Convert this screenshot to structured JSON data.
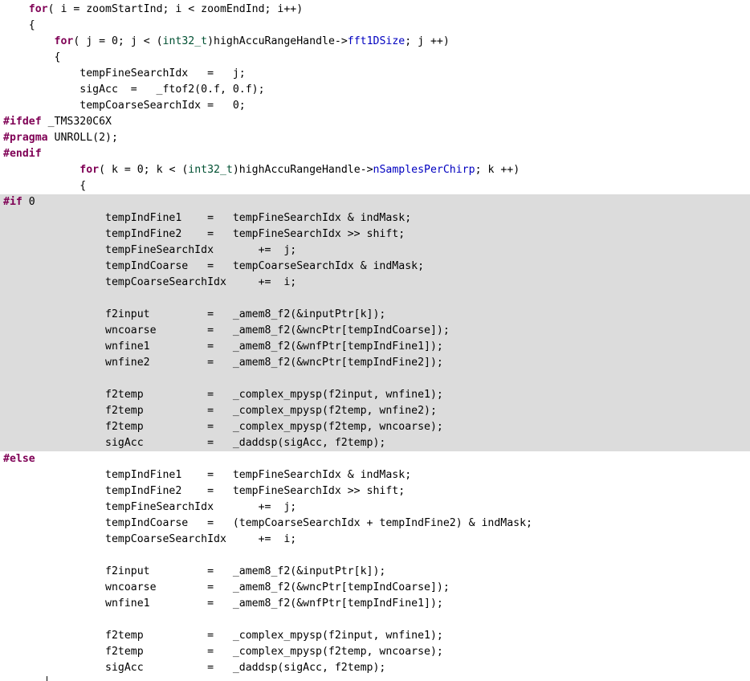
{
  "colors": {
    "background": "#ffffff",
    "inactive_block": "#dcdcdc",
    "keyword": "#7f0055",
    "type": "#005032",
    "field": "#0000c0",
    "text": "#000000"
  },
  "code": {
    "lines": [
      {
        "tokens": [
          {
            "t": "    ",
            "c": "plain"
          },
          {
            "t": "for",
            "c": "kw"
          },
          {
            "t": "( i = zoomStartInd; i < zoomEndInd; i++)",
            "c": "plain"
          }
        ]
      },
      {
        "tokens": [
          {
            "t": "    {",
            "c": "plain"
          }
        ]
      },
      {
        "tokens": [
          {
            "t": "        ",
            "c": "plain"
          },
          {
            "t": "for",
            "c": "kw"
          },
          {
            "t": "( j = 0; j < (",
            "c": "plain"
          },
          {
            "t": "int32_t",
            "c": "type"
          },
          {
            "t": ")highAccuRangeHandle->",
            "c": "plain"
          },
          {
            "t": "fft1DSize",
            "c": "field"
          },
          {
            "t": "; j ++)",
            "c": "plain"
          }
        ]
      },
      {
        "tokens": [
          {
            "t": "        {",
            "c": "plain"
          }
        ]
      },
      {
        "tokens": [
          {
            "t": "            tempFineSearchIdx   =   j;",
            "c": "plain"
          }
        ]
      },
      {
        "tokens": [
          {
            "t": "            sigAcc  =   _ftof2(0.f, 0.f);",
            "c": "plain"
          }
        ]
      },
      {
        "tokens": [
          {
            "t": "            tempCoarseSearchIdx =   0;",
            "c": "plain"
          }
        ]
      },
      {
        "tokens": [
          {
            "t": "#ifdef",
            "c": "pp"
          },
          {
            "t": " _TMS320C6X",
            "c": "plain"
          }
        ]
      },
      {
        "tokens": [
          {
            "t": "#pragma",
            "c": "pp"
          },
          {
            "t": " UNROLL(2);",
            "c": "plain"
          }
        ]
      },
      {
        "tokens": [
          {
            "t": "#endif",
            "c": "pp"
          }
        ]
      },
      {
        "tokens": [
          {
            "t": "            ",
            "c": "plain"
          },
          {
            "t": "for",
            "c": "kw"
          },
          {
            "t": "( k = 0; k < (",
            "c": "plain"
          },
          {
            "t": "int32_t",
            "c": "type"
          },
          {
            "t": ")highAccuRangeHandle->",
            "c": "plain"
          },
          {
            "t": "nSamplesPerChirp",
            "c": "field"
          },
          {
            "t": "; k ++)",
            "c": "plain"
          }
        ]
      },
      {
        "tokens": [
          {
            "t": "            {",
            "c": "plain"
          }
        ]
      },
      {
        "inactive": true,
        "tokens": [
          {
            "t": "#if",
            "c": "pp"
          },
          {
            "t": " 0",
            "c": "plain"
          }
        ]
      },
      {
        "inactive": true,
        "tokens": [
          {
            "t": "                tempIndFine1    =   tempFineSearchIdx & indMask;",
            "c": "plain"
          }
        ]
      },
      {
        "inactive": true,
        "tokens": [
          {
            "t": "                tempIndFine2    =   tempFineSearchIdx >> shift;",
            "c": "plain"
          }
        ]
      },
      {
        "inactive": true,
        "tokens": [
          {
            "t": "                tempFineSearchIdx       +=  j;",
            "c": "plain"
          }
        ]
      },
      {
        "inactive": true,
        "tokens": [
          {
            "t": "                tempIndCoarse   =   tempCoarseSearchIdx & indMask;",
            "c": "plain"
          }
        ]
      },
      {
        "inactive": true,
        "tokens": [
          {
            "t": "                tempCoarseSearchIdx     +=  i;",
            "c": "plain"
          }
        ]
      },
      {
        "inactive": true,
        "tokens": [
          {
            "t": "",
            "c": "plain"
          }
        ]
      },
      {
        "inactive": true,
        "tokens": [
          {
            "t": "                f2input         =   _amem8_f2(&inputPtr[k]);",
            "c": "plain"
          }
        ]
      },
      {
        "inactive": true,
        "tokens": [
          {
            "t": "                wncoarse        =   _amem8_f2(&wncPtr[tempIndCoarse]);",
            "c": "plain"
          }
        ]
      },
      {
        "inactive": true,
        "tokens": [
          {
            "t": "                wnfine1         =   _amem8_f2(&wnfPtr[tempIndFine1]);",
            "c": "plain"
          }
        ]
      },
      {
        "inactive": true,
        "tokens": [
          {
            "t": "                wnfine2         =   _amem8_f2(&wncPtr[tempIndFine2]);",
            "c": "plain"
          }
        ]
      },
      {
        "inactive": true,
        "tokens": [
          {
            "t": "",
            "c": "plain"
          }
        ]
      },
      {
        "inactive": true,
        "tokens": [
          {
            "t": "                f2temp          =   _complex_mpysp(f2input, wnfine1);",
            "c": "plain"
          }
        ]
      },
      {
        "inactive": true,
        "tokens": [
          {
            "t": "                f2temp          =   _complex_mpysp(f2temp, wnfine2);",
            "c": "plain"
          }
        ]
      },
      {
        "inactive": true,
        "tokens": [
          {
            "t": "                f2temp          =   _complex_mpysp(f2temp, wncoarse);",
            "c": "plain"
          }
        ]
      },
      {
        "inactive": true,
        "tokens": [
          {
            "t": "                sigAcc          =   _daddsp(sigAcc, f2temp);",
            "c": "plain"
          }
        ]
      },
      {
        "tokens": [
          {
            "t": "#else",
            "c": "pp"
          }
        ]
      },
      {
        "tokens": [
          {
            "t": "                tempIndFine1    =   tempFineSearchIdx & indMask;",
            "c": "plain"
          }
        ]
      },
      {
        "tokens": [
          {
            "t": "                tempIndFine2    =   tempFineSearchIdx >> shift;",
            "c": "plain"
          }
        ]
      },
      {
        "tokens": [
          {
            "t": "                tempFineSearchIdx       +=  j;",
            "c": "plain"
          }
        ]
      },
      {
        "tokens": [
          {
            "t": "                tempIndCoarse   =   (tempCoarseSearchIdx + tempIndFine2) & indMask;",
            "c": "plain"
          }
        ]
      },
      {
        "tokens": [
          {
            "t": "                tempCoarseSearchIdx     +=  i;",
            "c": "plain"
          }
        ]
      },
      {
        "tokens": [
          {
            "t": "",
            "c": "plain"
          }
        ]
      },
      {
        "tokens": [
          {
            "t": "                f2input         =   _amem8_f2(&inputPtr[k]);",
            "c": "plain"
          }
        ]
      },
      {
        "tokens": [
          {
            "t": "                wncoarse        =   _amem8_f2(&wncPtr[tempIndCoarse]);",
            "c": "plain"
          }
        ]
      },
      {
        "tokens": [
          {
            "t": "                wnfine1         =   _amem8_f2(&wnfPtr[tempIndFine1]);",
            "c": "plain"
          }
        ]
      },
      {
        "tokens": [
          {
            "t": "",
            "c": "plain"
          }
        ]
      },
      {
        "tokens": [
          {
            "t": "                f2temp          =   _complex_mpysp(f2input, wnfine1);",
            "c": "plain"
          }
        ]
      },
      {
        "tokens": [
          {
            "t": "                f2temp          =   _complex_mpysp(f2temp, wncoarse);",
            "c": "plain"
          }
        ]
      },
      {
        "tokens": [
          {
            "t": "                sigAcc          =   _daddsp(sigAcc, f2temp);",
            "c": "plain"
          }
        ]
      }
    ]
  }
}
